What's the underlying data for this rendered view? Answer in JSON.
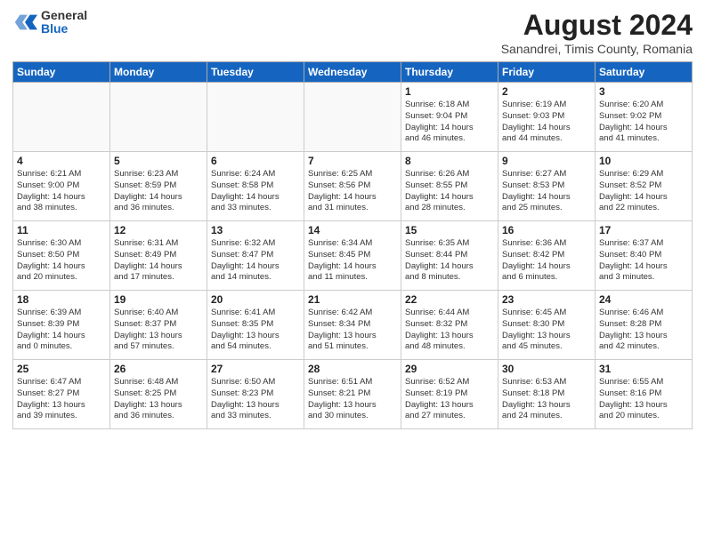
{
  "logo": {
    "general": "General",
    "blue": "Blue"
  },
  "title": {
    "month_year": "August 2024",
    "location": "Sanandrei, Timis County, Romania"
  },
  "days_of_week": [
    "Sunday",
    "Monday",
    "Tuesday",
    "Wednesday",
    "Thursday",
    "Friday",
    "Saturday"
  ],
  "weeks": [
    [
      {
        "num": "",
        "info": ""
      },
      {
        "num": "",
        "info": ""
      },
      {
        "num": "",
        "info": ""
      },
      {
        "num": "",
        "info": ""
      },
      {
        "num": "1",
        "info": "Sunrise: 6:18 AM\nSunset: 9:04 PM\nDaylight: 14 hours\nand 46 minutes."
      },
      {
        "num": "2",
        "info": "Sunrise: 6:19 AM\nSunset: 9:03 PM\nDaylight: 14 hours\nand 44 minutes."
      },
      {
        "num": "3",
        "info": "Sunrise: 6:20 AM\nSunset: 9:02 PM\nDaylight: 14 hours\nand 41 minutes."
      }
    ],
    [
      {
        "num": "4",
        "info": "Sunrise: 6:21 AM\nSunset: 9:00 PM\nDaylight: 14 hours\nand 38 minutes."
      },
      {
        "num": "5",
        "info": "Sunrise: 6:23 AM\nSunset: 8:59 PM\nDaylight: 14 hours\nand 36 minutes."
      },
      {
        "num": "6",
        "info": "Sunrise: 6:24 AM\nSunset: 8:58 PM\nDaylight: 14 hours\nand 33 minutes."
      },
      {
        "num": "7",
        "info": "Sunrise: 6:25 AM\nSunset: 8:56 PM\nDaylight: 14 hours\nand 31 minutes."
      },
      {
        "num": "8",
        "info": "Sunrise: 6:26 AM\nSunset: 8:55 PM\nDaylight: 14 hours\nand 28 minutes."
      },
      {
        "num": "9",
        "info": "Sunrise: 6:27 AM\nSunset: 8:53 PM\nDaylight: 14 hours\nand 25 minutes."
      },
      {
        "num": "10",
        "info": "Sunrise: 6:29 AM\nSunset: 8:52 PM\nDaylight: 14 hours\nand 22 minutes."
      }
    ],
    [
      {
        "num": "11",
        "info": "Sunrise: 6:30 AM\nSunset: 8:50 PM\nDaylight: 14 hours\nand 20 minutes."
      },
      {
        "num": "12",
        "info": "Sunrise: 6:31 AM\nSunset: 8:49 PM\nDaylight: 14 hours\nand 17 minutes."
      },
      {
        "num": "13",
        "info": "Sunrise: 6:32 AM\nSunset: 8:47 PM\nDaylight: 14 hours\nand 14 minutes."
      },
      {
        "num": "14",
        "info": "Sunrise: 6:34 AM\nSunset: 8:45 PM\nDaylight: 14 hours\nand 11 minutes."
      },
      {
        "num": "15",
        "info": "Sunrise: 6:35 AM\nSunset: 8:44 PM\nDaylight: 14 hours\nand 8 minutes."
      },
      {
        "num": "16",
        "info": "Sunrise: 6:36 AM\nSunset: 8:42 PM\nDaylight: 14 hours\nand 6 minutes."
      },
      {
        "num": "17",
        "info": "Sunrise: 6:37 AM\nSunset: 8:40 PM\nDaylight: 14 hours\nand 3 minutes."
      }
    ],
    [
      {
        "num": "18",
        "info": "Sunrise: 6:39 AM\nSunset: 8:39 PM\nDaylight: 14 hours\nand 0 minutes."
      },
      {
        "num": "19",
        "info": "Sunrise: 6:40 AM\nSunset: 8:37 PM\nDaylight: 13 hours\nand 57 minutes."
      },
      {
        "num": "20",
        "info": "Sunrise: 6:41 AM\nSunset: 8:35 PM\nDaylight: 13 hours\nand 54 minutes."
      },
      {
        "num": "21",
        "info": "Sunrise: 6:42 AM\nSunset: 8:34 PM\nDaylight: 13 hours\nand 51 minutes."
      },
      {
        "num": "22",
        "info": "Sunrise: 6:44 AM\nSunset: 8:32 PM\nDaylight: 13 hours\nand 48 minutes."
      },
      {
        "num": "23",
        "info": "Sunrise: 6:45 AM\nSunset: 8:30 PM\nDaylight: 13 hours\nand 45 minutes."
      },
      {
        "num": "24",
        "info": "Sunrise: 6:46 AM\nSunset: 8:28 PM\nDaylight: 13 hours\nand 42 minutes."
      }
    ],
    [
      {
        "num": "25",
        "info": "Sunrise: 6:47 AM\nSunset: 8:27 PM\nDaylight: 13 hours\nand 39 minutes."
      },
      {
        "num": "26",
        "info": "Sunrise: 6:48 AM\nSunset: 8:25 PM\nDaylight: 13 hours\nand 36 minutes."
      },
      {
        "num": "27",
        "info": "Sunrise: 6:50 AM\nSunset: 8:23 PM\nDaylight: 13 hours\nand 33 minutes."
      },
      {
        "num": "28",
        "info": "Sunrise: 6:51 AM\nSunset: 8:21 PM\nDaylight: 13 hours\nand 30 minutes."
      },
      {
        "num": "29",
        "info": "Sunrise: 6:52 AM\nSunset: 8:19 PM\nDaylight: 13 hours\nand 27 minutes."
      },
      {
        "num": "30",
        "info": "Sunrise: 6:53 AM\nSunset: 8:18 PM\nDaylight: 13 hours\nand 24 minutes."
      },
      {
        "num": "31",
        "info": "Sunrise: 6:55 AM\nSunset: 8:16 PM\nDaylight: 13 hours\nand 20 minutes."
      }
    ]
  ]
}
